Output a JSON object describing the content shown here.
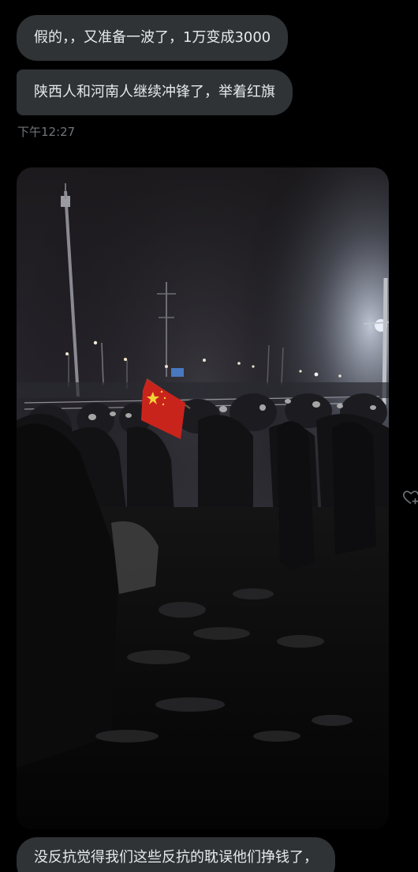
{
  "messages": [
    {
      "text": "假的，，又准备一波了，1万变成3000"
    },
    {
      "text": "陕西人和河南人继续冲锋了，举着红旗"
    }
  ],
  "timestamp": "下午12:27",
  "media": {
    "type": "photo",
    "scene": "night crowd with red flag"
  },
  "last_message": {
    "text": "没反抗觉得我们这些反抗的耽误他们挣钱了，"
  },
  "icons": {
    "reaction": "heart-plus-icon"
  },
  "colors": {
    "background": "#000000",
    "bubble": "#2f3336",
    "text": "#e7e9ea",
    "muted": "#71767b"
  }
}
